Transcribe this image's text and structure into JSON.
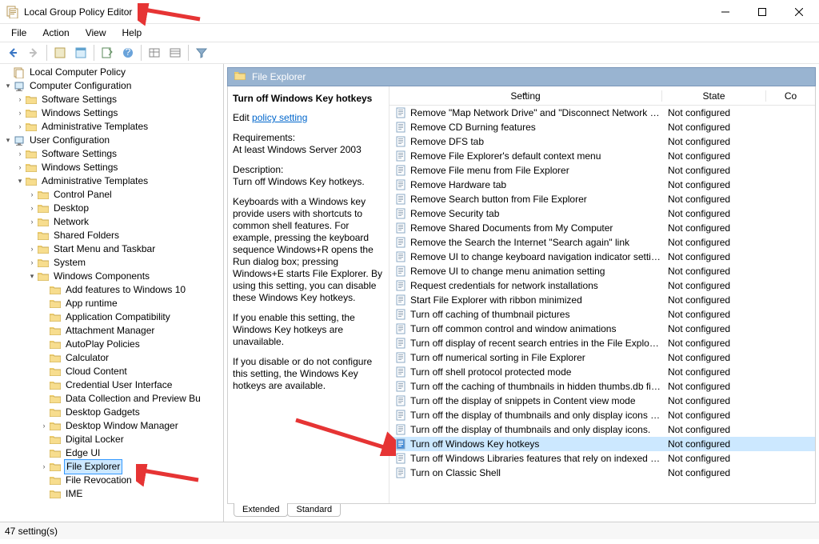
{
  "window": {
    "title": "Local Group Policy Editor",
    "menu": [
      "File",
      "Action",
      "View",
      "Help"
    ]
  },
  "tree": {
    "root_label": "Local Computer Policy",
    "comp_config": "Computer Configuration",
    "comp_children": [
      "Software Settings",
      "Windows Settings",
      "Administrative Templates"
    ],
    "user_config": "User Configuration",
    "user_software": "Software Settings",
    "user_windows": "Windows Settings",
    "user_admin": "Administrative Templates",
    "admin_nodes": [
      {
        "label": "Control Panel",
        "expandable": true
      },
      {
        "label": "Desktop",
        "expandable": true
      },
      {
        "label": "Network",
        "expandable": true
      },
      {
        "label": "Shared Folders",
        "expandable": false
      },
      {
        "label": "Start Menu and Taskbar",
        "expandable": true
      },
      {
        "label": "System",
        "expandable": true
      }
    ],
    "wincomp": "Windows Components",
    "wincomp_children": [
      {
        "label": "Add features to Windows 10",
        "expandable": false
      },
      {
        "label": "App runtime",
        "expandable": false
      },
      {
        "label": "Application Compatibility",
        "expandable": false
      },
      {
        "label": "Attachment Manager",
        "expandable": false
      },
      {
        "label": "AutoPlay Policies",
        "expandable": false
      },
      {
        "label": "Calculator",
        "expandable": false
      },
      {
        "label": "Cloud Content",
        "expandable": false
      },
      {
        "label": "Credential User Interface",
        "expandable": false
      },
      {
        "label": "Data Collection and Preview Bu",
        "expandable": false
      },
      {
        "label": "Desktop Gadgets",
        "expandable": false
      },
      {
        "label": "Desktop Window Manager",
        "expandable": true
      },
      {
        "label": "Digital Locker",
        "expandable": false
      },
      {
        "label": "Edge UI",
        "expandable": false
      },
      {
        "label": "File Explorer",
        "expandable": true,
        "selected": true
      },
      {
        "label": "File Revocation",
        "expandable": false
      },
      {
        "label": "IME",
        "expandable": false
      }
    ]
  },
  "header": {
    "title": "File Explorer"
  },
  "info": {
    "selected_name": "Turn off Windows Key hotkeys",
    "edit_prefix": "Edit ",
    "edit_link": "policy setting ",
    "req_label": "Requirements:",
    "req_value": "At least Windows Server 2003",
    "desc_label": "Description:",
    "desc_value": "Turn off Windows Key hotkeys.",
    "para1": "Keyboards with a Windows key provide users with shortcuts to common shell features. For example, pressing the keyboard sequence Windows+R opens the Run dialog box; pressing Windows+E starts File Explorer. By using this setting, you can disable these Windows Key hotkeys.",
    "para2": "If you enable this setting, the Windows Key hotkeys are unavailable.",
    "para3": "If you disable or do not configure this setting, the Windows Key hotkeys are available."
  },
  "columns": {
    "setting": "Setting",
    "state": "State",
    "co": "Co"
  },
  "rows": [
    {
      "setting": "Remove \"Map Network Drive\" and \"Disconnect Network Dri...",
      "state": "Not configured"
    },
    {
      "setting": "Remove CD Burning features",
      "state": "Not configured"
    },
    {
      "setting": "Remove DFS tab",
      "state": "Not configured"
    },
    {
      "setting": "Remove File Explorer's default context menu",
      "state": "Not configured"
    },
    {
      "setting": "Remove File menu from File Explorer",
      "state": "Not configured"
    },
    {
      "setting": "Remove Hardware tab",
      "state": "Not configured"
    },
    {
      "setting": "Remove Search button from File Explorer",
      "state": "Not configured"
    },
    {
      "setting": "Remove Security tab",
      "state": "Not configured"
    },
    {
      "setting": "Remove Shared Documents from My Computer",
      "state": "Not configured"
    },
    {
      "setting": "Remove the Search the Internet \"Search again\" link",
      "state": "Not configured"
    },
    {
      "setting": "Remove UI to change keyboard navigation indicator setting",
      "state": "Not configured"
    },
    {
      "setting": "Remove UI to change menu animation setting",
      "state": "Not configured"
    },
    {
      "setting": "Request credentials for network installations",
      "state": "Not configured"
    },
    {
      "setting": "Start File Explorer with ribbon minimized",
      "state": "Not configured"
    },
    {
      "setting": "Turn off caching of thumbnail pictures",
      "state": "Not configured"
    },
    {
      "setting": "Turn off common control and window animations",
      "state": "Not configured"
    },
    {
      "setting": "Turn off display of recent search entries in the File Explorer s...",
      "state": "Not configured"
    },
    {
      "setting": "Turn off numerical sorting in File Explorer",
      "state": "Not configured"
    },
    {
      "setting": "Turn off shell protocol protected mode",
      "state": "Not configured"
    },
    {
      "setting": "Turn off the caching of thumbnails in hidden thumbs.db files",
      "state": "Not configured"
    },
    {
      "setting": "Turn off the display of snippets in Content view mode",
      "state": "Not configured"
    },
    {
      "setting": "Turn off the display of thumbnails and only display icons on...",
      "state": "Not configured"
    },
    {
      "setting": "Turn off the display of thumbnails and only display icons.",
      "state": "Not configured"
    },
    {
      "setting": "Turn off Windows Key hotkeys",
      "state": "Not configured",
      "selected": true
    },
    {
      "setting": "Turn off Windows Libraries features that rely on indexed file ...",
      "state": "Not configured"
    },
    {
      "setting": "Turn on Classic Shell",
      "state": "Not configured"
    }
  ],
  "tabs": {
    "extended": "Extended",
    "standard": "Standard"
  },
  "status": "47 setting(s)"
}
